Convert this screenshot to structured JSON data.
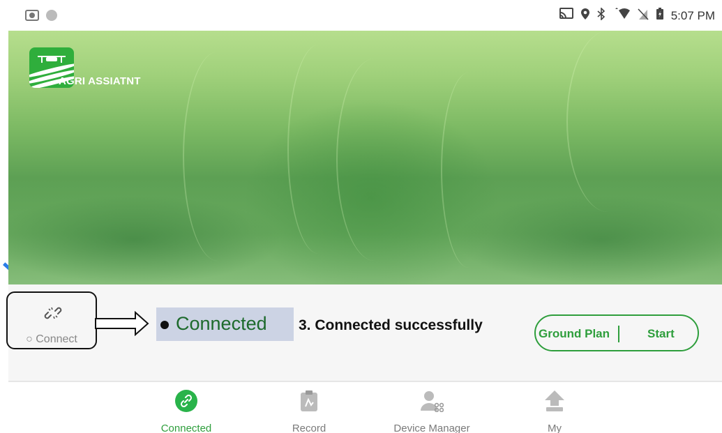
{
  "status_bar": {
    "time": "5:07 PM",
    "icons": [
      "screen-record-icon",
      "circle-icon",
      "cast-icon",
      "location-icon",
      "bluetooth-icon",
      "wifi-icon",
      "no-sim-icon",
      "battery-charging-icon"
    ]
  },
  "banner": {
    "brand_name": "AGRI ASSIATNT",
    "logo": "drone-field-logo"
  },
  "connect_panel": {
    "connect_label": "○ Connect",
    "connect_icon": "broken-link-icon",
    "status_text": "Connected",
    "callout": "3.  Connected successfully",
    "ground_plan_label": "Ground Plan",
    "start_label": "Start"
  },
  "colors": {
    "accent": "#2e9e3c",
    "callout_chip": "#ccd3e4",
    "decor_line": "#2b7de9"
  },
  "bottom_nav": {
    "items": [
      {
        "label": "Connected",
        "icon": "link-icon",
        "active": true
      },
      {
        "label": "Record",
        "icon": "clipboard-icon",
        "active": false
      },
      {
        "label": "Device Manager",
        "icon": "user-drone-icon",
        "active": false
      },
      {
        "label": "My",
        "icon": "upload-user-icon",
        "active": false
      }
    ]
  }
}
